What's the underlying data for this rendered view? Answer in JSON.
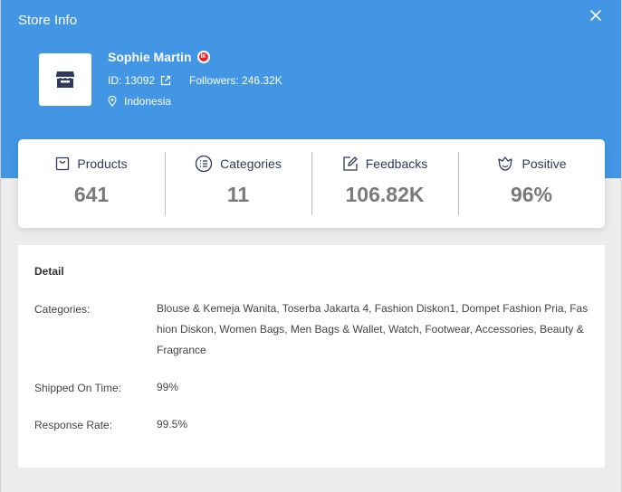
{
  "modal": {
    "title": "Store Info"
  },
  "store": {
    "name": "Sophie Martin",
    "badge_text": "IK",
    "id_text": "ID: 13092",
    "followers_text": "Followers: 246.32K",
    "location": "Indonesia"
  },
  "stats": [
    {
      "label": "Products",
      "value": "641",
      "icon": "bag-icon"
    },
    {
      "label": "Categories",
      "value": "11",
      "icon": "list-circle-icon"
    },
    {
      "label": "Feedbacks",
      "value": "106.82K",
      "icon": "edit-icon"
    },
    {
      "label": "Positive",
      "value": "96%",
      "icon": "flower-icon"
    }
  ],
  "detail": {
    "title": "Detail",
    "categories_label": "Categories:",
    "categories_value": "Blouse & Kemeja Wanita, Toserba Jakarta 4, Fashion Diskon1, Dompet Fashion Pria, Fashion Diskon, Women Bags, Men Bags & Wallet, Watch, Footwear, Accessories, Beauty & Fragrance",
    "shipped_label": "Shipped On Time:",
    "shipped_value": "99%",
    "response_label": "Response Rate:",
    "response_value": "99.5%"
  },
  "colors": {
    "header_blue": "#4296e4",
    "stat_label": "#2d3a5c",
    "stat_value": "#7a7a7a",
    "badge_red": "#e8232d"
  }
}
